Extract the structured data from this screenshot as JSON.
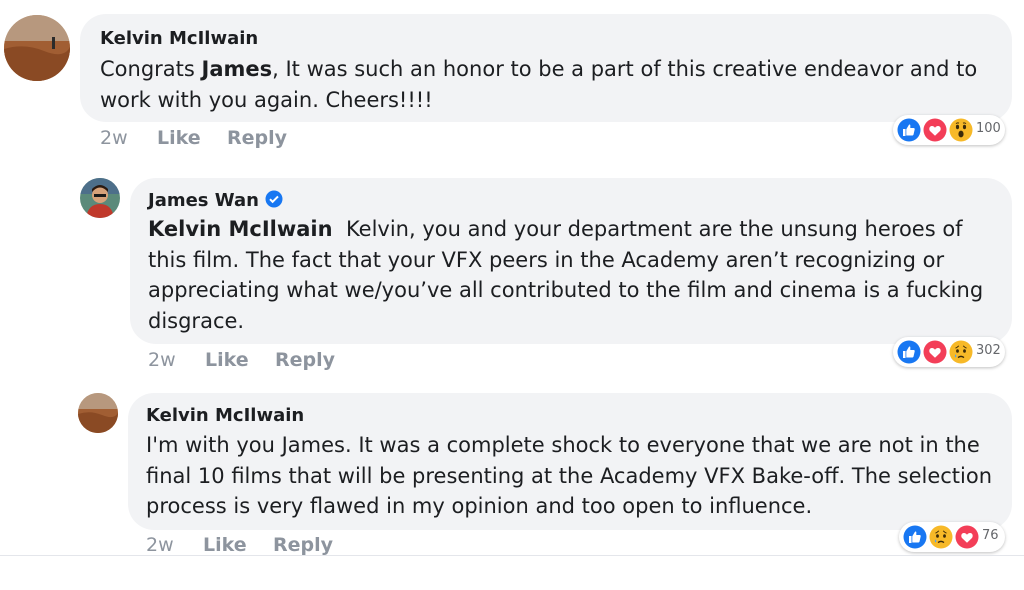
{
  "comments": [
    {
      "author": "Kelvin McIlwain",
      "text_prefix": "Congrats ",
      "mention": "James",
      "text": ", It was such an honor to be a part of this creative endeavor and to work with you again. Cheers!!!!",
      "time": "2w",
      "like_label": "Like",
      "reply_label": "Reply",
      "reaction_count": "100",
      "reactions": [
        "like-icon",
        "love-icon",
        "wow-icon"
      ]
    },
    {
      "author": "James Wan",
      "verified": true,
      "mention": "Kelvin McIlwain",
      "text": "Kelvin, you and your department are the unsung heroes of this film. The fact that your VFX peers in the Academy aren’t recognizing or appreciating what we/you’ve all contributed to the film and cinema is a fucking disgrace.",
      "time": "2w",
      "like_label": "Like",
      "reply_label": "Reply",
      "reaction_count": "302",
      "reactions": [
        "like-icon",
        "love-icon",
        "sad-icon"
      ]
    },
    {
      "author": "Kelvin McIlwain",
      "text": "I'm with you James. It was a complete shock to everyone that we are not in the final 10 films that will be presenting at the Academy VFX Bake-off. The selection process is very flawed in my opinion and too open to influence.",
      "time": "2w",
      "like_label": "Like",
      "reply_label": "Reply",
      "reaction_count": "76",
      "reactions": [
        "like-icon",
        "sad-icon",
        "love-icon"
      ]
    }
  ],
  "colors": {
    "bubble": "#f2f3f5",
    "text": "#1c1e21",
    "meta": "#8d949e",
    "like_blue": "#1877f2",
    "love_red": "#f33e58",
    "emoji_yellow": "#f7b928"
  }
}
